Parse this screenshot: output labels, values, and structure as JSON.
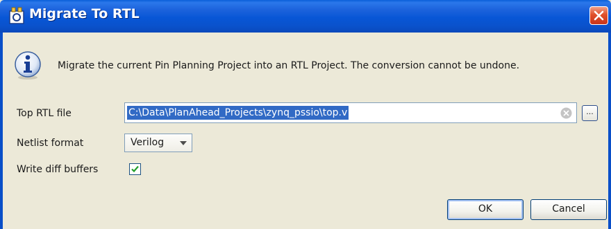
{
  "dialog": {
    "title": "Migrate To RTL",
    "message": "Migrate the current Pin Planning Project into an RTL Project. The conversion cannot be undone."
  },
  "form": {
    "top_rtl_label": "Top RTL file",
    "top_rtl_value": "C:\\Data\\PlanAhead_Projects\\zynq_pssio\\top.v",
    "browse_label": "...",
    "netlist_label": "Netlist format",
    "netlist_value": "Verilog",
    "diff_label": "Write diff buffers",
    "diff_checked": true
  },
  "buttons": {
    "ok": "OK",
    "cancel": "Cancel"
  },
  "icons": {
    "title": "app-icon",
    "close": "close-icon",
    "info": "info-icon",
    "clear": "clear-icon",
    "dropdown": "chevron-down-icon",
    "check": "checkmark-icon"
  },
  "colors": {
    "titlebar": "#0a56d6",
    "close": "#d9482a",
    "selection": "#316ac5",
    "check": "#22a02a"
  }
}
